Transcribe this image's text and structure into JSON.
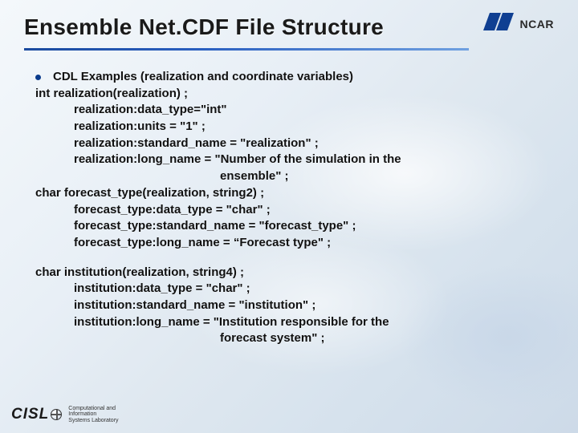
{
  "header": {
    "title": "Ensemble Net.CDF File Structure",
    "logo_text": "NCAR"
  },
  "content": {
    "bullet": "CDL Examples (realization and coordinate variables)",
    "lines_block1": [
      "int realization(realization) ;",
      "realization:data_type=\"int\"",
      "realization:units = \"1\" ;",
      "realization:standard_name = \"realization\" ;",
      "realization:long_name = \"Number of the simulation in the",
      "ensemble\" ;",
      "char forecast_type(realization, string2) ;",
      "forecast_type:data_type = \"char\" ;",
      "forecast_type:standard_name = \"forecast_type\" ;",
      "forecast_type:long_name = “Forecast type\" ;"
    ],
    "lines_block2": [
      "char institution(realization, string4) ;",
      "institution:data_type = \"char\" ;",
      "institution:standard_name = \"institution\" ;",
      "institution:long_name = \"Institution responsible for the",
      "forecast system\" ;"
    ]
  },
  "footer": {
    "cisl": "CISL",
    "cisl_sub1": "Computational and",
    "cisl_sub2": "Information",
    "cisl_sub3": "Systems Laboratory"
  }
}
